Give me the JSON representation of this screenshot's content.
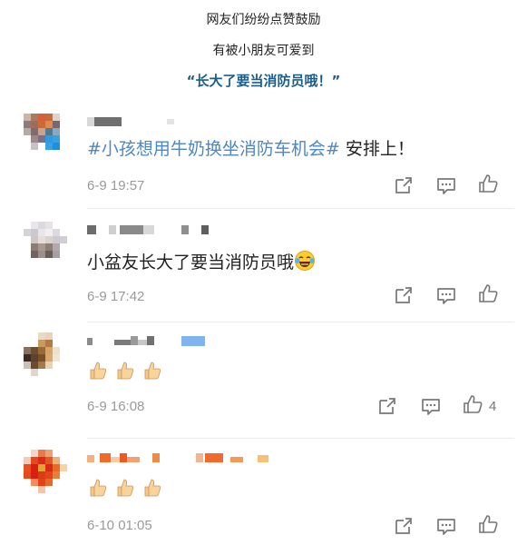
{
  "captions": {
    "line1": "网友们纷纷点赞鼓励",
    "line2": "有被小朋友可爱到",
    "line3": "“长大了要当消防员哦！”"
  },
  "comments": [
    {
      "hashtag": "#小孩想用牛奶换坐消防车机会#",
      "text": " 安排上！",
      "time": "6-9 19:57"
    },
    {
      "text": "小盆友长大了要当消防员哦",
      "emoji": "laughing-tears-emoji",
      "time": "6-9 17:42"
    },
    {
      "emoji": "thumbs-up-emoji ×3",
      "time": "6-9 16:08",
      "like_count": "4"
    },
    {
      "emoji": "thumbs-up-emoji ×3",
      "time": "6-10 01:05"
    }
  ],
  "icons": {
    "share": "share-icon",
    "comment": "comment-icon",
    "like": "like-icon"
  },
  "colors": {
    "hashtag": "#4d87c7",
    "caption_highlight": "#1b5e8a",
    "timestamp": "#9a9a9a"
  }
}
